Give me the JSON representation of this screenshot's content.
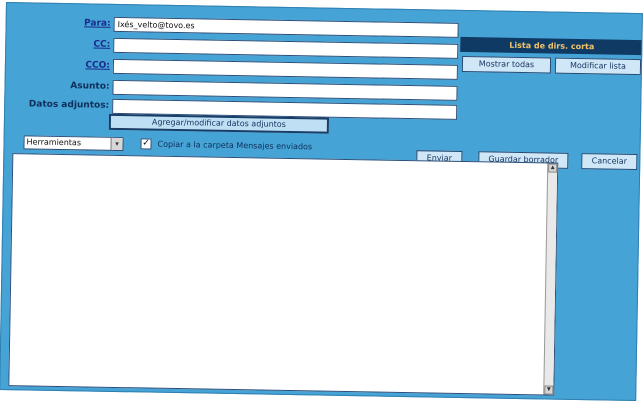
{
  "form": {
    "to_label": "Para:",
    "to_value": "Ixés_velto@tovo.es",
    "cc_label": "CC:",
    "cc_value": "",
    "bcc_label": "CCO:",
    "bcc_value": "",
    "subject_label": "Asunto:",
    "subject_value": "",
    "attachments_label": "Datos adjuntos:",
    "attachments_value": "",
    "attach_button": "Agregar/modificar datos adjuntos"
  },
  "address_panel": {
    "title": "Lista de dirs. corta",
    "show_all": "Mostrar todas",
    "modify_list": "Modificar lista"
  },
  "toolbar": {
    "tools_select": "Herramientas",
    "copy_checked": true,
    "copy_label": "Copiar a la carpeta Mensajes enviados",
    "send": "Enviar",
    "save_draft": "Guardar borrador",
    "cancel": "Cancelar"
  },
  "message": {
    "body": ""
  },
  "icons": {
    "dropdown": "chevron-down-icon",
    "scroll_up": "scroll-up-icon",
    "scroll_down": "scroll-down-icon"
  }
}
